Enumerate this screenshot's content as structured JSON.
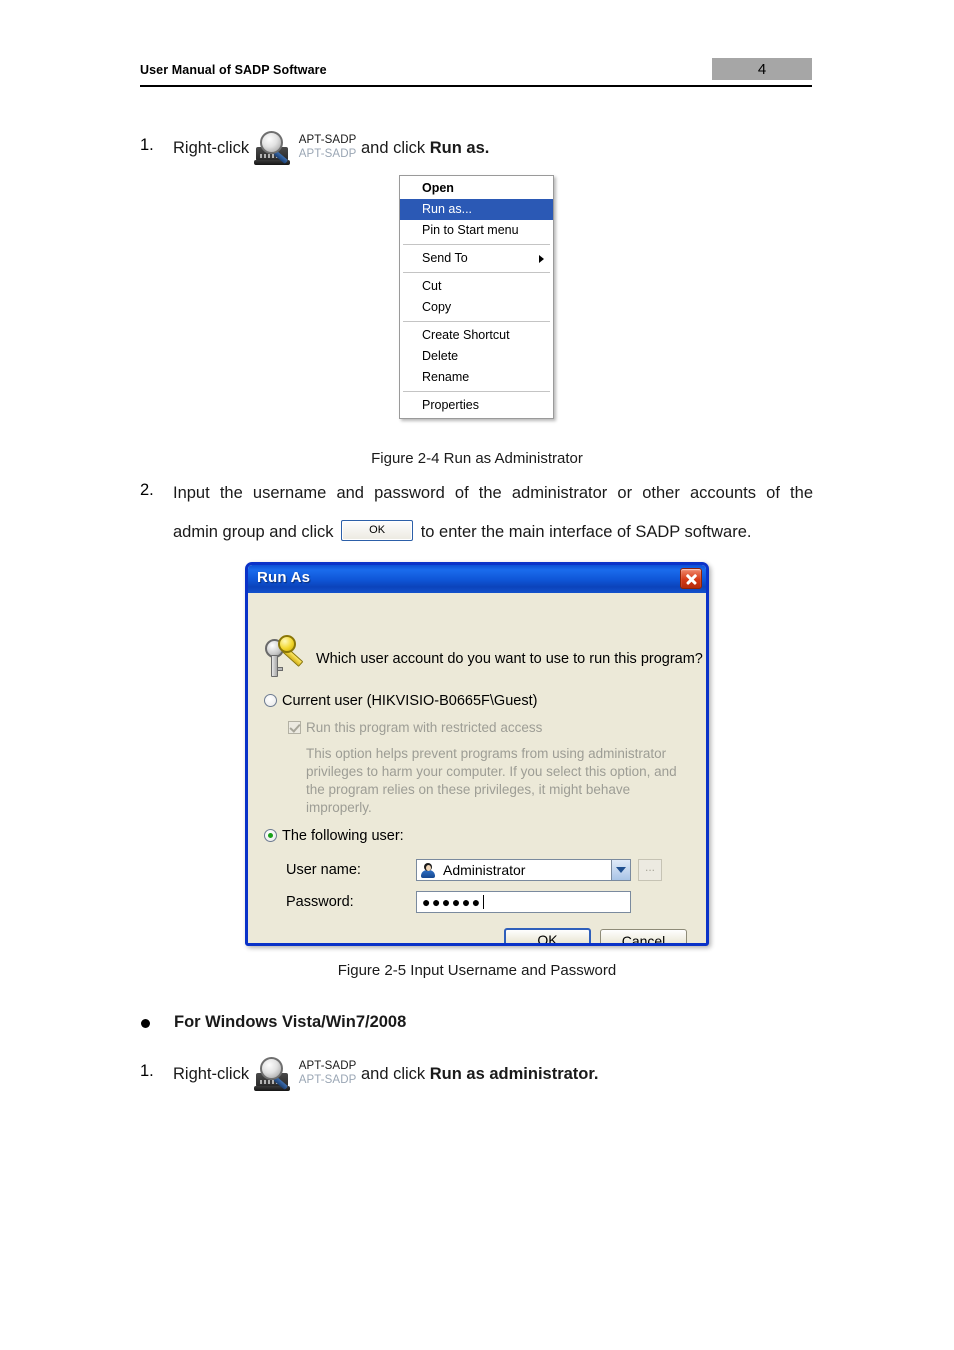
{
  "header": {
    "title": "User Manual of SADP Software",
    "page_number": "4"
  },
  "steps": {
    "step1_num": "1.",
    "step1_prefix": "Right-click",
    "step1_suffix_plain": "and click ",
    "step1_suffix_bold": "Run as.",
    "step2_num": "2.",
    "step2_line1": "Input the username and password of the administrator or other accounts of the",
    "step2_line2_a": "admin group and click",
    "step2_ok_label": "OK",
    "step2_line2_b": "to enter the main interface of SADP software.",
    "step3_num": "1.",
    "step3_prefix": "Right-click",
    "step3_suffix_plain": "and click ",
    "step3_suffix_bold": "Run as administrator."
  },
  "app_icon": {
    "name": "APT-SADP",
    "label_top": "APT-SADP",
    "label_bottom": "APT-SADP"
  },
  "context_menu": {
    "items": [
      {
        "label": "Open",
        "bold": true,
        "selected": false,
        "submenu": false
      },
      {
        "label": "Run as...",
        "bold": false,
        "selected": true,
        "submenu": false
      },
      {
        "label": "Pin to Start menu",
        "bold": false,
        "selected": false,
        "submenu": false
      },
      {
        "label": "Send To",
        "bold": false,
        "selected": false,
        "submenu": true
      },
      {
        "label": "Cut",
        "bold": false,
        "selected": false,
        "submenu": false
      },
      {
        "label": "Copy",
        "bold": false,
        "selected": false,
        "submenu": false
      },
      {
        "label": "Create Shortcut",
        "bold": false,
        "selected": false,
        "submenu": false
      },
      {
        "label": "Delete",
        "bold": false,
        "selected": false,
        "submenu": false
      },
      {
        "label": "Rename",
        "bold": false,
        "selected": false,
        "submenu": false
      },
      {
        "label": "Properties",
        "bold": false,
        "selected": false,
        "submenu": false
      }
    ],
    "highlight_color": "#2b59b5"
  },
  "figure_captions": {
    "fig_2_4": "Figure 2-4 Run as Administrator",
    "fig_2_5": "Figure 2-5 Input Username and Password"
  },
  "bullet_section": {
    "bullet_label": "For Windows Vista/Win7/2008"
  },
  "runas_dialog": {
    "title": "Run As",
    "question": "Which user account do you want to use to run this program?",
    "current_user_label": "Current user (HIKVISIO-B0665F\\Guest)",
    "restricted_label": "Run this program with restricted access",
    "help_text": "This option helps prevent programs from using administrator privileges to harm your computer.  If you select this option, and the program relies on these privileges, it might behave improperly.",
    "following_user_label": "The following user:",
    "username_label": "User name:",
    "username_value": "Administrator",
    "browse_label": "...",
    "password_label": "Password:",
    "password_value": "●●●●●●",
    "ok_label": "OK",
    "cancel_label": "Cancel",
    "titlebar_color": "#0f56d8",
    "body_color": "#ece9d8",
    "border_color": "#0a32c8"
  }
}
